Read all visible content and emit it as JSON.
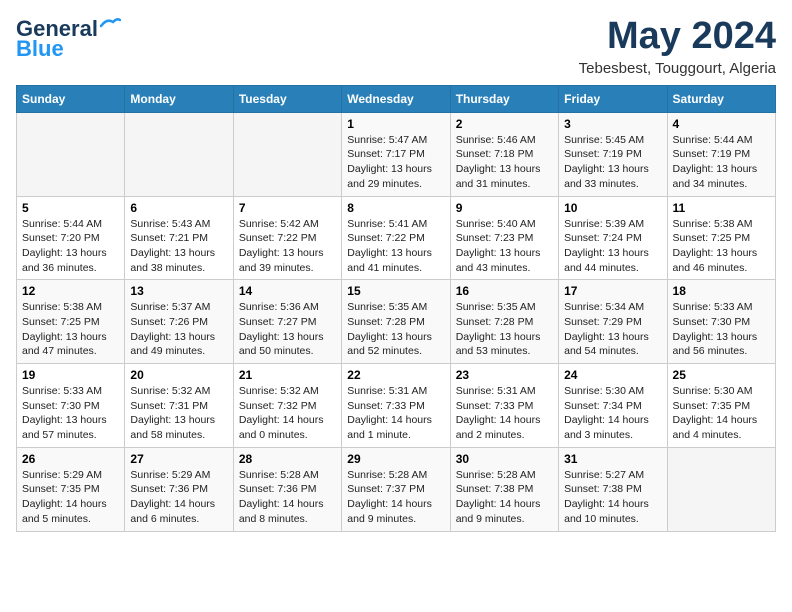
{
  "logo": {
    "line1": "General",
    "line2": "Blue"
  },
  "title": "May 2024",
  "subtitle": "Tebesbest, Touggourt, Algeria",
  "headers": [
    "Sunday",
    "Monday",
    "Tuesday",
    "Wednesday",
    "Thursday",
    "Friday",
    "Saturday"
  ],
  "weeks": [
    [
      {
        "day": "",
        "info": ""
      },
      {
        "day": "",
        "info": ""
      },
      {
        "day": "",
        "info": ""
      },
      {
        "day": "1",
        "info": "Sunrise: 5:47 AM\nSunset: 7:17 PM\nDaylight: 13 hours and 29 minutes."
      },
      {
        "day": "2",
        "info": "Sunrise: 5:46 AM\nSunset: 7:18 PM\nDaylight: 13 hours and 31 minutes."
      },
      {
        "day": "3",
        "info": "Sunrise: 5:45 AM\nSunset: 7:19 PM\nDaylight: 13 hours and 33 minutes."
      },
      {
        "day": "4",
        "info": "Sunrise: 5:44 AM\nSunset: 7:19 PM\nDaylight: 13 hours and 34 minutes."
      }
    ],
    [
      {
        "day": "5",
        "info": "Sunrise: 5:44 AM\nSunset: 7:20 PM\nDaylight: 13 hours and 36 minutes."
      },
      {
        "day": "6",
        "info": "Sunrise: 5:43 AM\nSunset: 7:21 PM\nDaylight: 13 hours and 38 minutes."
      },
      {
        "day": "7",
        "info": "Sunrise: 5:42 AM\nSunset: 7:22 PM\nDaylight: 13 hours and 39 minutes."
      },
      {
        "day": "8",
        "info": "Sunrise: 5:41 AM\nSunset: 7:22 PM\nDaylight: 13 hours and 41 minutes."
      },
      {
        "day": "9",
        "info": "Sunrise: 5:40 AM\nSunset: 7:23 PM\nDaylight: 13 hours and 43 minutes."
      },
      {
        "day": "10",
        "info": "Sunrise: 5:39 AM\nSunset: 7:24 PM\nDaylight: 13 hours and 44 minutes."
      },
      {
        "day": "11",
        "info": "Sunrise: 5:38 AM\nSunset: 7:25 PM\nDaylight: 13 hours and 46 minutes."
      }
    ],
    [
      {
        "day": "12",
        "info": "Sunrise: 5:38 AM\nSunset: 7:25 PM\nDaylight: 13 hours and 47 minutes."
      },
      {
        "day": "13",
        "info": "Sunrise: 5:37 AM\nSunset: 7:26 PM\nDaylight: 13 hours and 49 minutes."
      },
      {
        "day": "14",
        "info": "Sunrise: 5:36 AM\nSunset: 7:27 PM\nDaylight: 13 hours and 50 minutes."
      },
      {
        "day": "15",
        "info": "Sunrise: 5:35 AM\nSunset: 7:28 PM\nDaylight: 13 hours and 52 minutes."
      },
      {
        "day": "16",
        "info": "Sunrise: 5:35 AM\nSunset: 7:28 PM\nDaylight: 13 hours and 53 minutes."
      },
      {
        "day": "17",
        "info": "Sunrise: 5:34 AM\nSunset: 7:29 PM\nDaylight: 13 hours and 54 minutes."
      },
      {
        "day": "18",
        "info": "Sunrise: 5:33 AM\nSunset: 7:30 PM\nDaylight: 13 hours and 56 minutes."
      }
    ],
    [
      {
        "day": "19",
        "info": "Sunrise: 5:33 AM\nSunset: 7:30 PM\nDaylight: 13 hours and 57 minutes."
      },
      {
        "day": "20",
        "info": "Sunrise: 5:32 AM\nSunset: 7:31 PM\nDaylight: 13 hours and 58 minutes."
      },
      {
        "day": "21",
        "info": "Sunrise: 5:32 AM\nSunset: 7:32 PM\nDaylight: 14 hours and 0 minutes."
      },
      {
        "day": "22",
        "info": "Sunrise: 5:31 AM\nSunset: 7:33 PM\nDaylight: 14 hours and 1 minute."
      },
      {
        "day": "23",
        "info": "Sunrise: 5:31 AM\nSunset: 7:33 PM\nDaylight: 14 hours and 2 minutes."
      },
      {
        "day": "24",
        "info": "Sunrise: 5:30 AM\nSunset: 7:34 PM\nDaylight: 14 hours and 3 minutes."
      },
      {
        "day": "25",
        "info": "Sunrise: 5:30 AM\nSunset: 7:35 PM\nDaylight: 14 hours and 4 minutes."
      }
    ],
    [
      {
        "day": "26",
        "info": "Sunrise: 5:29 AM\nSunset: 7:35 PM\nDaylight: 14 hours and 5 minutes."
      },
      {
        "day": "27",
        "info": "Sunrise: 5:29 AM\nSunset: 7:36 PM\nDaylight: 14 hours and 6 minutes."
      },
      {
        "day": "28",
        "info": "Sunrise: 5:28 AM\nSunset: 7:36 PM\nDaylight: 14 hours and 8 minutes."
      },
      {
        "day": "29",
        "info": "Sunrise: 5:28 AM\nSunset: 7:37 PM\nDaylight: 14 hours and 9 minutes."
      },
      {
        "day": "30",
        "info": "Sunrise: 5:28 AM\nSunset: 7:38 PM\nDaylight: 14 hours and 9 minutes."
      },
      {
        "day": "31",
        "info": "Sunrise: 5:27 AM\nSunset: 7:38 PM\nDaylight: 14 hours and 10 minutes."
      },
      {
        "day": "",
        "info": ""
      }
    ]
  ]
}
